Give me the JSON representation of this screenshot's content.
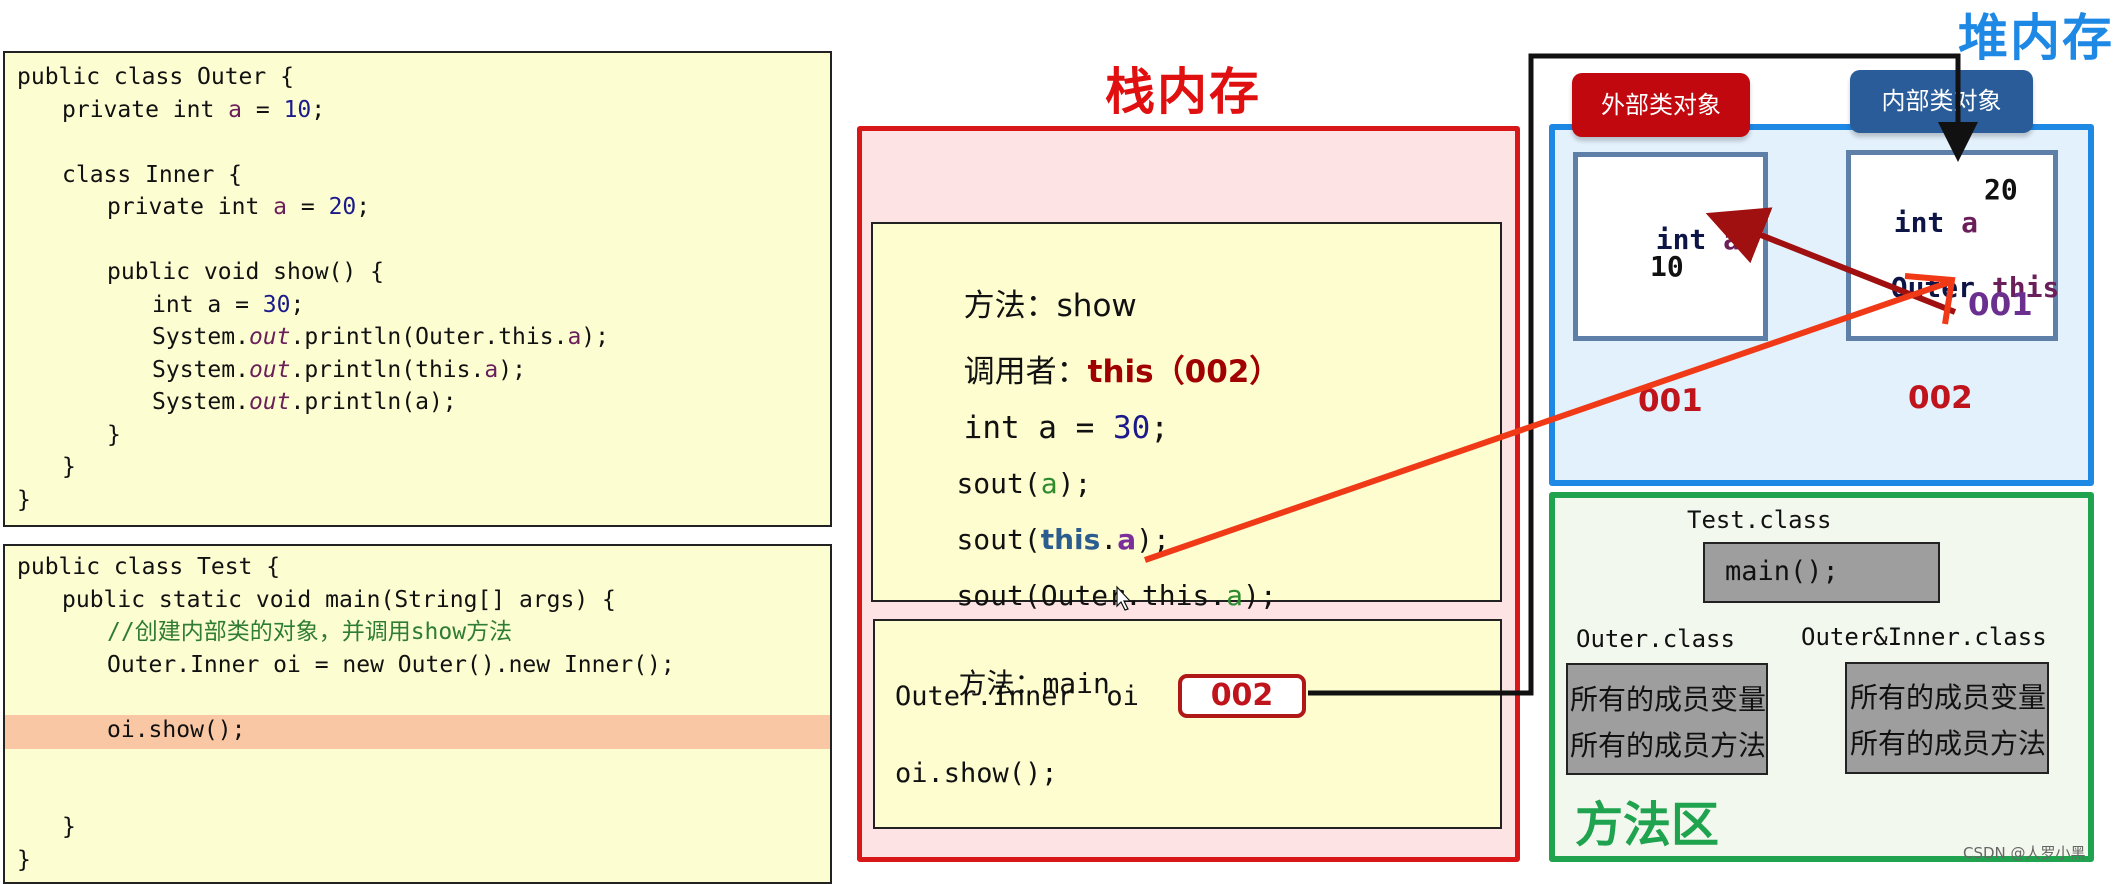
{
  "code_outer": {
    "lines": [
      {
        "indent": 0,
        "parts": [
          {
            "t": "public class Outer {",
            "c": "kw"
          }
        ]
      },
      {
        "indent": 1,
        "parts": [
          {
            "t": "private int ",
            "c": "kw"
          },
          {
            "t": "a",
            "c": "fld"
          },
          {
            "t": " = ",
            "c": "kw"
          },
          {
            "t": "10",
            "c": "num"
          },
          {
            "t": ";",
            "c": "kw"
          }
        ]
      },
      {
        "indent": 0,
        "parts": []
      },
      {
        "indent": 1,
        "parts": [
          {
            "t": "class Inner {",
            "c": "kw"
          }
        ]
      },
      {
        "indent": 2,
        "parts": [
          {
            "t": "private int ",
            "c": "kw"
          },
          {
            "t": "a",
            "c": "fld"
          },
          {
            "t": " = ",
            "c": "kw"
          },
          {
            "t": "20",
            "c": "num"
          },
          {
            "t": ";",
            "c": "kw"
          }
        ]
      },
      {
        "indent": 0,
        "parts": []
      },
      {
        "indent": 2,
        "parts": [
          {
            "t": "public void show() {",
            "c": "kw"
          }
        ]
      },
      {
        "indent": 3,
        "parts": [
          {
            "t": "int a = ",
            "c": "kw"
          },
          {
            "t": "30",
            "c": "num"
          },
          {
            "t": ";",
            "c": "kw"
          }
        ]
      },
      {
        "indent": 3,
        "parts": [
          {
            "t": "System.",
            "c": "kw"
          },
          {
            "t": "out",
            "c": "it"
          },
          {
            "t": ".println(Outer.this.",
            "c": "kw"
          },
          {
            "t": "a",
            "c": "fld"
          },
          {
            "t": ");",
            "c": "kw"
          }
        ]
      },
      {
        "indent": 3,
        "parts": [
          {
            "t": "System.",
            "c": "kw"
          },
          {
            "t": "out",
            "c": "it"
          },
          {
            "t": ".println(this.",
            "c": "kw"
          },
          {
            "t": "a",
            "c": "fld"
          },
          {
            "t": ");",
            "c": "kw"
          }
        ]
      },
      {
        "indent": 3,
        "parts": [
          {
            "t": "System.",
            "c": "kw"
          },
          {
            "t": "out",
            "c": "it"
          },
          {
            "t": ".println(a);",
            "c": "kw"
          }
        ]
      },
      {
        "indent": 2,
        "parts": [
          {
            "t": "}",
            "c": "kw"
          }
        ]
      },
      {
        "indent": 1,
        "parts": [
          {
            "t": "}",
            "c": "kw"
          }
        ]
      },
      {
        "indent": 0,
        "parts": [
          {
            "t": "}",
            "c": "kw"
          }
        ]
      }
    ]
  },
  "code_test": {
    "highlighted_line": 5,
    "lines": [
      {
        "indent": 0,
        "parts": [
          {
            "t": "public class Test {",
            "c": "kw"
          }
        ]
      },
      {
        "indent": 1,
        "parts": [
          {
            "t": "public static void main(String[] args) {",
            "c": "kw"
          }
        ]
      },
      {
        "indent": 2,
        "parts": [
          {
            "t": "//创建内部类的对象，并调用show方法",
            "c": "cmt"
          }
        ]
      },
      {
        "indent": 2,
        "parts": [
          {
            "t": "Outer.Inner oi = new Outer().new Inner();",
            "c": "kw"
          }
        ]
      },
      {
        "indent": 0,
        "parts": []
      },
      {
        "indent": 2,
        "parts": [
          {
            "t": "oi.show();",
            "c": "kw"
          }
        ]
      },
      {
        "indent": 0,
        "parts": []
      },
      {
        "indent": 0,
        "parts": []
      },
      {
        "indent": 1,
        "parts": [
          {
            "t": "}",
            "c": "kw"
          }
        ]
      },
      {
        "indent": 0,
        "parts": [
          {
            "t": "}",
            "c": "kw"
          }
        ]
      }
    ]
  },
  "stack": {
    "title": "栈内存",
    "show_frame": {
      "method_label": "方法：",
      "method_name": "show",
      "caller_label": "调用者：",
      "caller_value": "this（002）",
      "local_decl_prefix": "int a = ",
      "local_decl_value": "30",
      "local_decl_suffix": ";",
      "sout1": {
        "pre": "sout(",
        "var": "a",
        "post": ");"
      },
      "sout2": {
        "pre": "sout(",
        "this": "this",
        "dot": ".",
        "var": "a",
        "post": ");"
      },
      "sout3": {
        "pre": "sout(Outer.this.",
        "var": "a",
        "post": ");"
      }
    },
    "main_frame": {
      "method_label": "方法：",
      "method_name": "main",
      "var_decl": "Outer.Inner  oi",
      "ref_value": "002",
      "call": "oi.show();"
    }
  },
  "heap": {
    "title": "堆内存",
    "outer_object": {
      "label": "外部类对象",
      "field_type": "int ",
      "field_name": "a",
      "field_value": "10",
      "address": "001"
    },
    "inner_object": {
      "label": "内部类对象",
      "field_type": "int ",
      "field_name": "a",
      "field_value": "20",
      "outer_ref_type": "Outer ",
      "outer_ref_name": "this",
      "outer_ref_value": "001",
      "address": "002"
    }
  },
  "method_area": {
    "title": "方法区",
    "test_class": {
      "name": "Test.class",
      "content": "main();"
    },
    "outer_class": {
      "name": "Outer.class",
      "line1": "所有的成员变量",
      "line2": "所有的成员方法"
    },
    "inner_class": {
      "name": "Outer&Inner.class",
      "line1": "所有的成员变量",
      "line2": "所有的成员方法"
    }
  },
  "watermark": "CSDN @人罗小黑",
  "colors": {
    "stack_red": "#d81818",
    "heap_blue": "#1e88e5",
    "method_green": "#1fa34f",
    "arrow_orange": "#f03a17",
    "arrow_darkred": "#a01010"
  }
}
